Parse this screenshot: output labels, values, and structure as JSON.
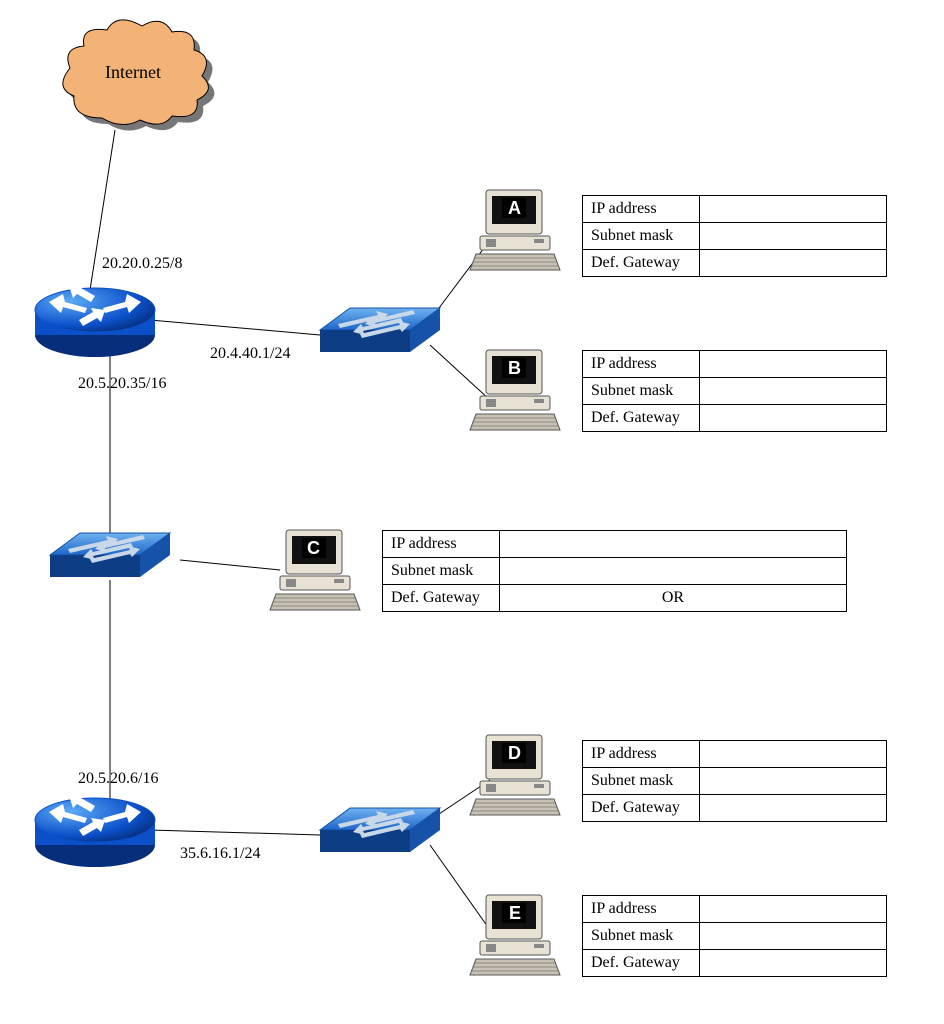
{
  "cloud": {
    "label": "Internet"
  },
  "router1": {
    "if_up": "20.20.0.25/8",
    "if_right": "20.4.40.1/24",
    "if_down": "20.5.20.35/16"
  },
  "router2": {
    "if_up": "20.5.20.6/16",
    "if_right": "35.6.16.1/24"
  },
  "hosts": {
    "A": {
      "letter": "A",
      "fields": {
        "ip": "IP address",
        "mask": "Subnet mask",
        "gw": "Def. Gateway"
      },
      "values": {
        "ip": "",
        "mask": "",
        "gw": ""
      }
    },
    "B": {
      "letter": "B",
      "fields": {
        "ip": "IP address",
        "mask": "Subnet mask",
        "gw": "Def. Gateway"
      },
      "values": {
        "ip": "",
        "mask": "",
        "gw": ""
      }
    },
    "C": {
      "letter": "C",
      "fields": {
        "ip": "IP address",
        "mask": "Subnet mask",
        "gw": "Def. Gateway"
      },
      "values": {
        "ip": "",
        "mask": "",
        "gw": "OR"
      }
    },
    "D": {
      "letter": "D",
      "fields": {
        "ip": "IP address",
        "mask": "Subnet mask",
        "gw": "Def. Gateway"
      },
      "values": {
        "ip": "",
        "mask": "",
        "gw": ""
      }
    },
    "E": {
      "letter": "E",
      "fields": {
        "ip": "IP address",
        "mask": "Subnet mask",
        "gw": "Def. Gateway"
      },
      "values": {
        "ip": "",
        "mask": "",
        "gw": ""
      }
    }
  }
}
